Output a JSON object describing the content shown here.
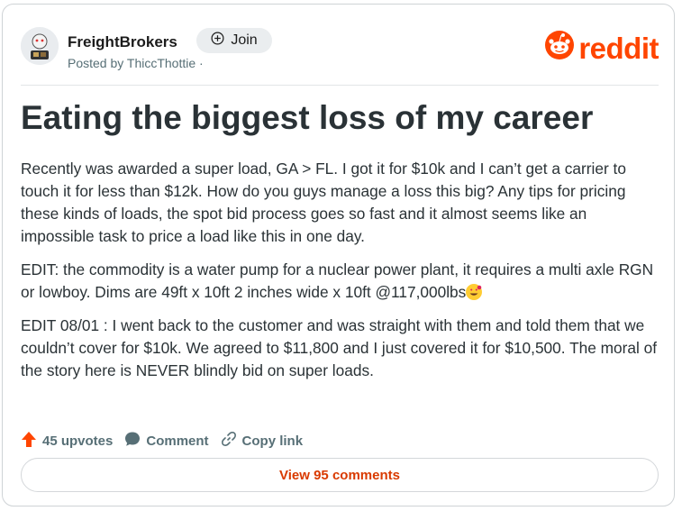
{
  "post": {
    "subreddit": "FreightBrokers",
    "join_label": "Join",
    "posted_by": "Posted by ThiccThottie ·",
    "brand": "reddit",
    "title": "Eating the biggest loss of my career",
    "paragraphs": [
      "Recently was awarded a super load, GA > FL. I got it for $10k and I can’t get a carrier to touch it for less than $12k. How do you guys manage a loss this big? Any tips for pricing these kinds of loads, the spot bid process goes so fast and it almost seems like an impossible task to price a load like this in one day.",
      "EDIT: the commodity is a water pump for a nuclear power plant, it requires a multi axle RGN or lowboy. Dims are 49ft x 10ft 2 inches wide x 10ft @117,000lbs",
      "EDIT 08/01 : I went back to the customer and was straight with them and told them that we couldn’t cover for $10k. We agreed to $11,800 and I just covered it for $10,500. The moral of the story here is NEVER blindly bid on super loads."
    ],
    "upvotes": "45 upvotes",
    "comment_label": "Comment",
    "copy_link_label": "Copy link",
    "view_comments": "View 95 comments"
  },
  "colors": {
    "brand": "#ff4500",
    "upvote": "#ff4500",
    "link": "#d93a00",
    "muted": "#576f76"
  },
  "icons": {
    "join": "plus-circle-icon",
    "logo": "reddit-snoo-icon",
    "upvote": "upvote-arrow-icon",
    "comment": "comment-bubble-icon",
    "copy_link": "link-icon",
    "emoji": "grinning-heart-eyes-emoji"
  }
}
